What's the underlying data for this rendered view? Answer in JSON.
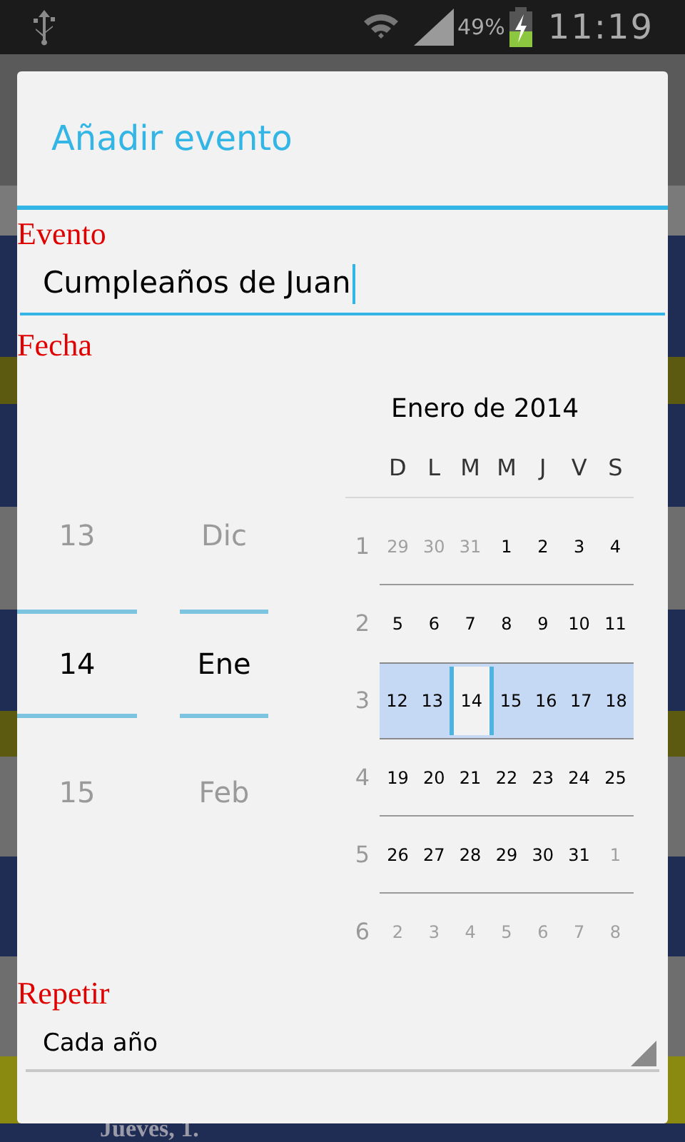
{
  "status_bar": {
    "battery": "49%",
    "time": "11:19"
  },
  "background": {
    "footer_text": "Jueves, 1."
  },
  "dialog": {
    "title": "Añadir evento",
    "event": {
      "label": "Evento",
      "value": "Cumpleaños de Juan"
    },
    "date": {
      "label": "Fecha",
      "day_picker": [
        {
          "label": "13",
          "selected": false
        },
        {
          "label": "14",
          "selected": true
        },
        {
          "label": "15",
          "selected": false
        }
      ],
      "month_picker": [
        {
          "label": "Dic",
          "selected": false
        },
        {
          "label": "Ene",
          "selected": true
        },
        {
          "label": "Feb",
          "selected": false
        }
      ],
      "calendar": {
        "title": "Enero de 2014",
        "weekdays": [
          "D",
          "L",
          "M",
          "M",
          "J",
          "V",
          "S"
        ],
        "weeks": [
          {
            "number": "1",
            "selected": false,
            "days": [
              {
                "label": "29",
                "in_month": false,
                "selected": false
              },
              {
                "label": "30",
                "in_month": false,
                "selected": false
              },
              {
                "label": "31",
                "in_month": false,
                "selected": false
              },
              {
                "label": "1",
                "in_month": true,
                "selected": false
              },
              {
                "label": "2",
                "in_month": true,
                "selected": false
              },
              {
                "label": "3",
                "in_month": true,
                "selected": false
              },
              {
                "label": "4",
                "in_month": true,
                "selected": false
              }
            ]
          },
          {
            "number": "2",
            "selected": false,
            "days": [
              {
                "label": "5",
                "in_month": true,
                "selected": false
              },
              {
                "label": "6",
                "in_month": true,
                "selected": false
              },
              {
                "label": "7",
                "in_month": true,
                "selected": false
              },
              {
                "label": "8",
                "in_month": true,
                "selected": false
              },
              {
                "label": "9",
                "in_month": true,
                "selected": false
              },
              {
                "label": "10",
                "in_month": true,
                "selected": false
              },
              {
                "label": "11",
                "in_month": true,
                "selected": false
              }
            ]
          },
          {
            "number": "3",
            "selected": true,
            "days": [
              {
                "label": "12",
                "in_month": true,
                "selected": false
              },
              {
                "label": "13",
                "in_month": true,
                "selected": false
              },
              {
                "label": "14",
                "in_month": true,
                "selected": true
              },
              {
                "label": "15",
                "in_month": true,
                "selected": false
              },
              {
                "label": "16",
                "in_month": true,
                "selected": false
              },
              {
                "label": "17",
                "in_month": true,
                "selected": false
              },
              {
                "label": "18",
                "in_month": true,
                "selected": false
              }
            ]
          },
          {
            "number": "4",
            "selected": false,
            "days": [
              {
                "label": "19",
                "in_month": true,
                "selected": false
              },
              {
                "label": "20",
                "in_month": true,
                "selected": false
              },
              {
                "label": "21",
                "in_month": true,
                "selected": false
              },
              {
                "label": "22",
                "in_month": true,
                "selected": false
              },
              {
                "label": "23",
                "in_month": true,
                "selected": false
              },
              {
                "label": "24",
                "in_month": true,
                "selected": false
              },
              {
                "label": "25",
                "in_month": true,
                "selected": false
              }
            ]
          },
          {
            "number": "5",
            "selected": false,
            "days": [
              {
                "label": "26",
                "in_month": true,
                "selected": false
              },
              {
                "label": "27",
                "in_month": true,
                "selected": false
              },
              {
                "label": "28",
                "in_month": true,
                "selected": false
              },
              {
                "label": "29",
                "in_month": true,
                "selected": false
              },
              {
                "label": "30",
                "in_month": true,
                "selected": false
              },
              {
                "label": "31",
                "in_month": true,
                "selected": false
              },
              {
                "label": "1",
                "in_month": false,
                "selected": false
              }
            ]
          },
          {
            "number": "6",
            "selected": false,
            "days": [
              {
                "label": "2",
                "in_month": false,
                "selected": false
              },
              {
                "label": "3",
                "in_month": false,
                "selected": false
              },
              {
                "label": "4",
                "in_month": false,
                "selected": false
              },
              {
                "label": "5",
                "in_month": false,
                "selected": false
              },
              {
                "label": "6",
                "in_month": false,
                "selected": false
              },
              {
                "label": "7",
                "in_month": false,
                "selected": false
              },
              {
                "label": "8",
                "in_month": false,
                "selected": false
              }
            ]
          }
        ]
      }
    },
    "repeat": {
      "label": "Repetir",
      "value": "Cada año"
    }
  }
}
